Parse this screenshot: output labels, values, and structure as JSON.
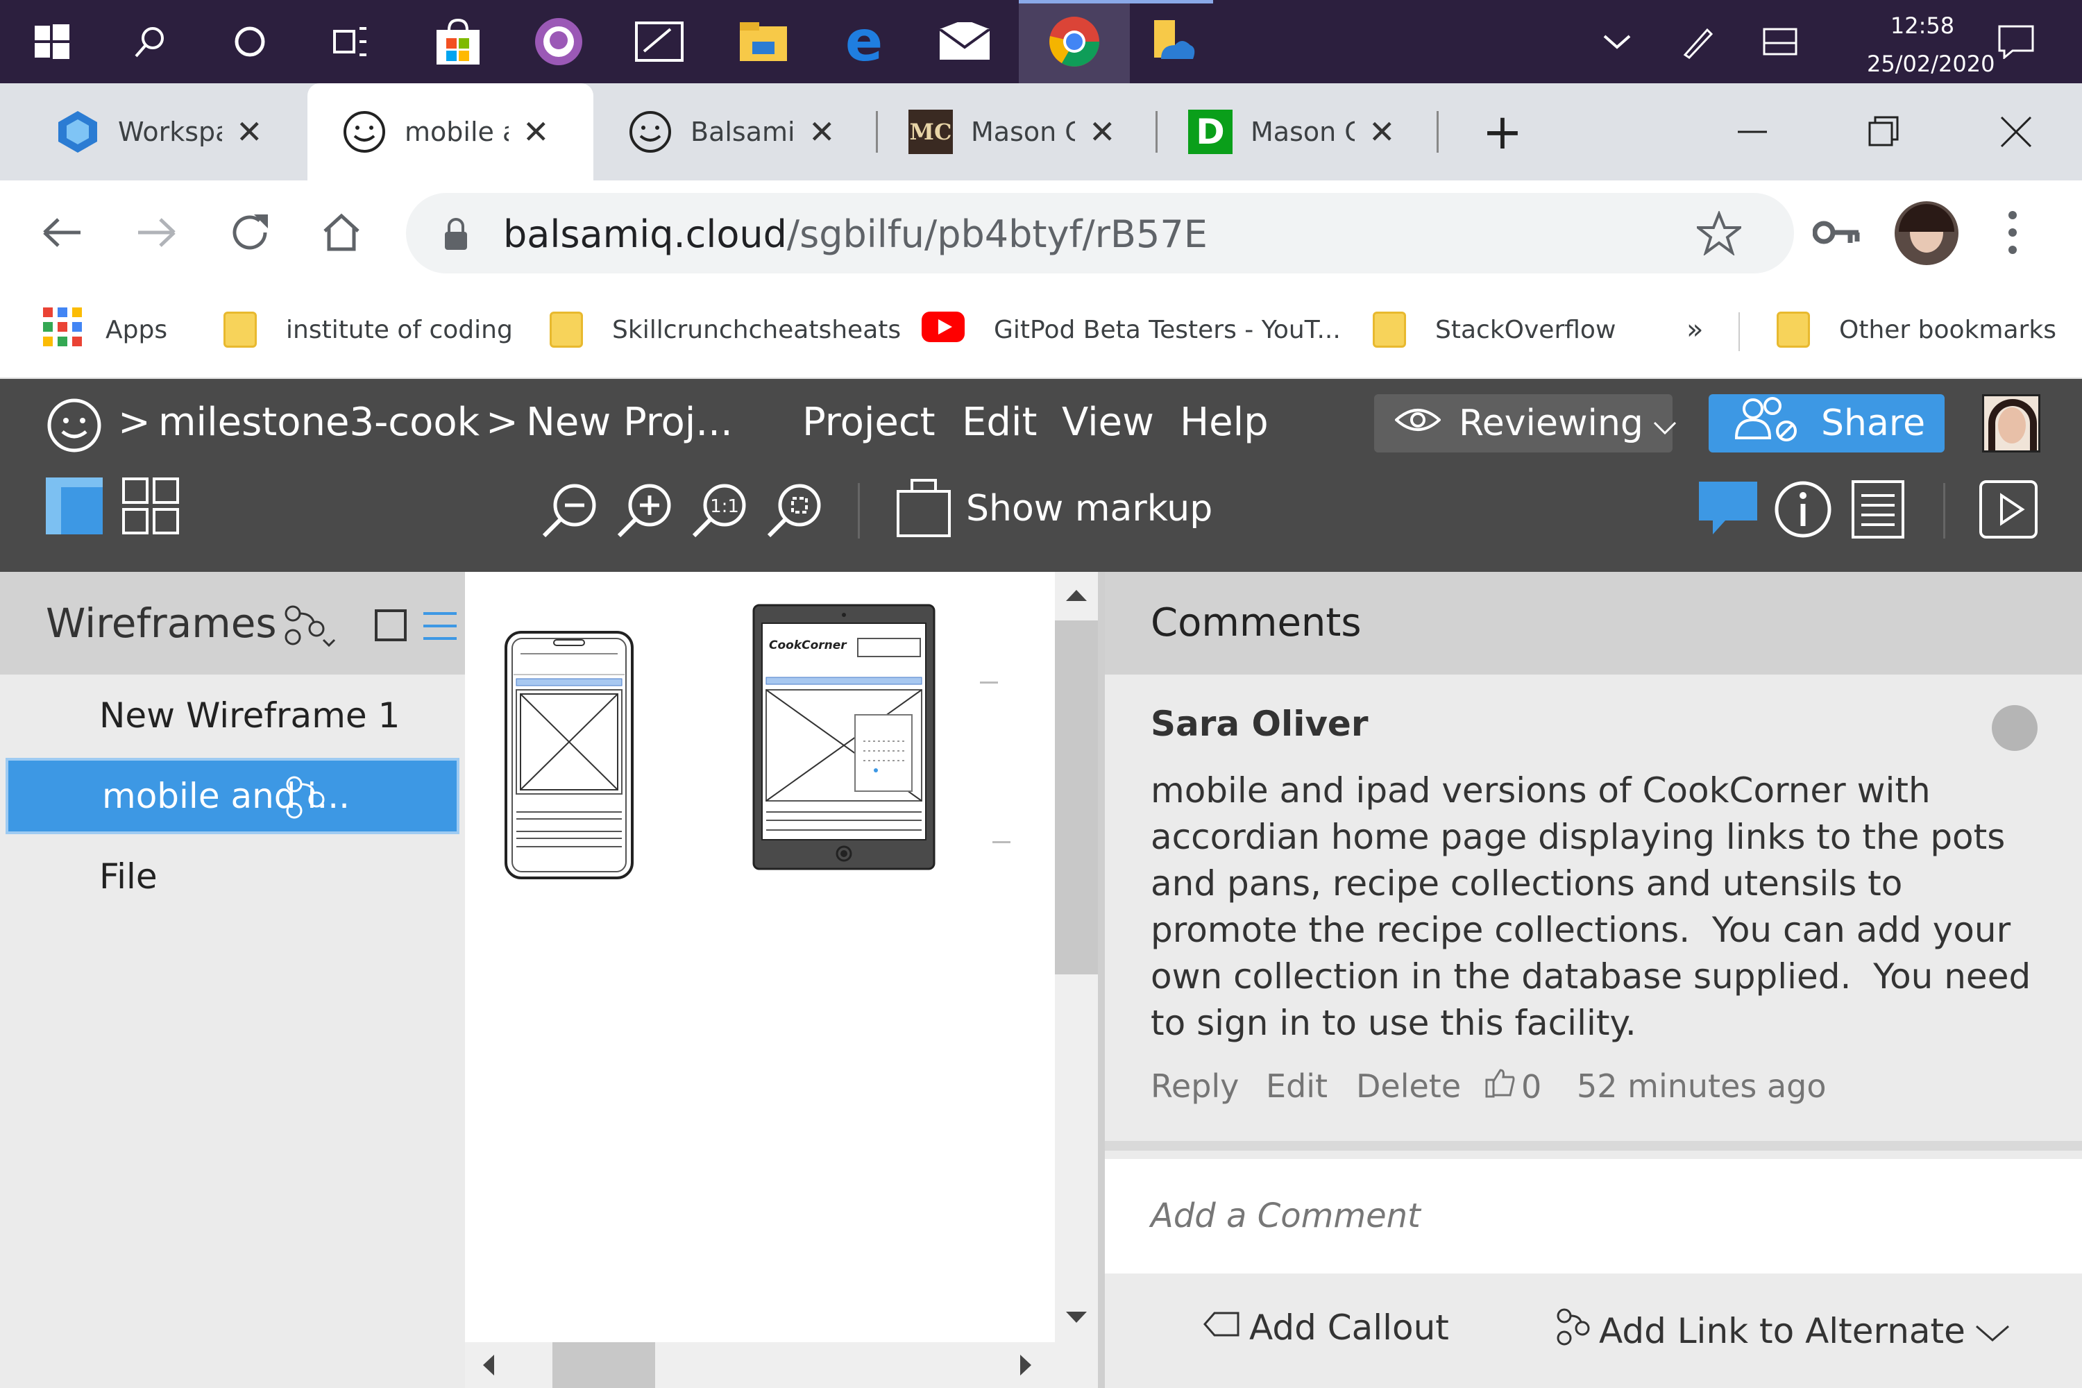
{
  "taskbar": {
    "time": "12:58",
    "date": "25/02/2020",
    "icons": [
      "windows-start-icon",
      "search-icon",
      "cortana-icon",
      "task-view-icon",
      "store-icon",
      "github-icon",
      "whiteboard-icon",
      "file-explorer-icon",
      "edge-icon",
      "mail-icon",
      "chrome-icon",
      "onedrive-icon"
    ]
  },
  "tabs": [
    {
      "title": "Workspa",
      "icon": "gitpod-icon"
    },
    {
      "title": "mobile a",
      "icon": "balsamiq-icon"
    },
    {
      "title": "Balsamic",
      "icon": "balsamiq-icon"
    },
    {
      "title": "Mason C",
      "icon": "mc-icon",
      "badge": "MC"
    },
    {
      "title": "Mason C",
      "icon": "d-icon",
      "badge": "D"
    }
  ],
  "address": {
    "host": "balsamiq.cloud",
    "path": "/sgbilfu/pb4btyf/rB57E"
  },
  "bookmarks": {
    "apps": "Apps",
    "items": [
      "institute of coding",
      "Skillcrunchcheatsheats",
      "GitPod Beta Testers - YouT...",
      "StackOverflow"
    ],
    "more": "»",
    "other": "Other bookmarks"
  },
  "app": {
    "breadcrumb_sep": ">",
    "project": "milestone3-cook",
    "file": "New Proj...",
    "menu": [
      "Project",
      "Edit",
      "View",
      "Help"
    ],
    "reviewing": "Reviewing",
    "share": "Share",
    "show_markup": "Show markup"
  },
  "wireframes": {
    "title": "Wireframes",
    "items": [
      "New Wireframe 1",
      "mobile and i...",
      "File"
    ],
    "selected_index": 1
  },
  "canvas": {
    "tablet_brand": "CookCorner"
  },
  "comments": {
    "title": "Comments",
    "author": "Sara Oliver",
    "body": "mobile and ipad versions of CookCorner with accordian home page displaying links to the pots and pans, recipe collections and utensils to promote the recipe collections.  You can add your own collection in the database supplied.  You need to sign in to use this facility.",
    "reply": "Reply",
    "edit": "Edit",
    "delete": "Delete",
    "likes": "0",
    "time": "52 minutes ago",
    "placeholder": "Add a Comment",
    "add_callout": "Add Callout",
    "add_link": "Add Link to Alternate"
  },
  "colors": {
    "accent": "#3d98e4",
    "header": "#4a4a4a",
    "taskbar": "#2c1f3e"
  }
}
